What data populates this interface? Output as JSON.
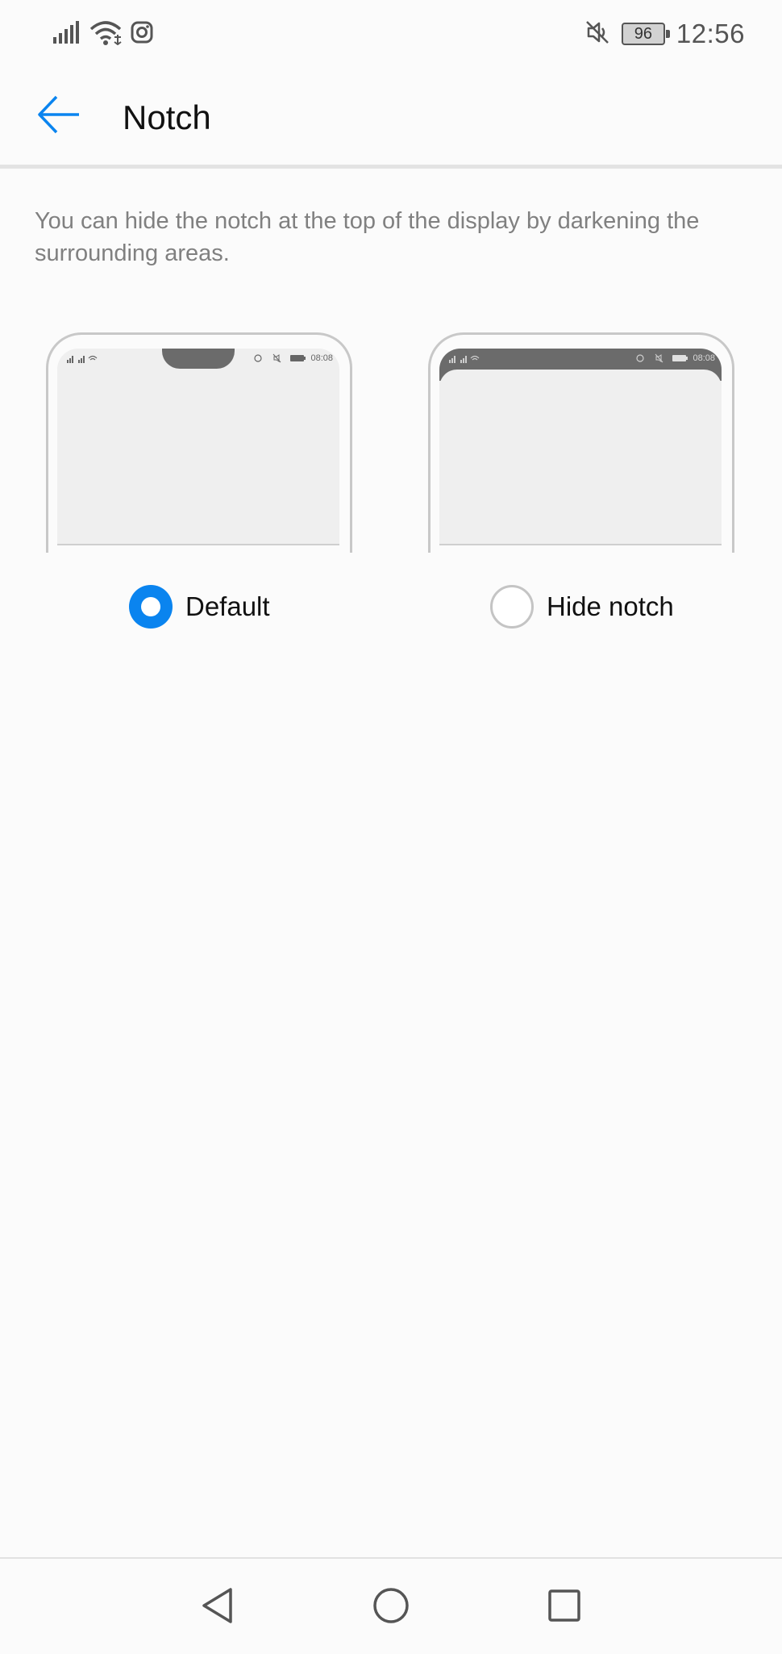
{
  "status_bar": {
    "time": "12:56",
    "battery": "96",
    "icons": [
      "signal-icon",
      "wifi-icon",
      "instagram-icon",
      "mute-icon",
      "battery-icon"
    ]
  },
  "header": {
    "title": "Notch",
    "back_icon": "back-arrow-icon"
  },
  "description": "You can hide the notch at the top of the display by darkening the surrounding areas.",
  "previews": {
    "time": "08:08"
  },
  "options": [
    {
      "label": "Default",
      "selected": true
    },
    {
      "label": "Hide notch",
      "selected": false
    }
  ],
  "nav": {
    "icons": [
      "back-triangle-icon",
      "home-circle-icon",
      "recents-square-icon"
    ]
  },
  "colors": {
    "accent": "#0a84ef",
    "notch_gray": "#6b6b6b"
  }
}
